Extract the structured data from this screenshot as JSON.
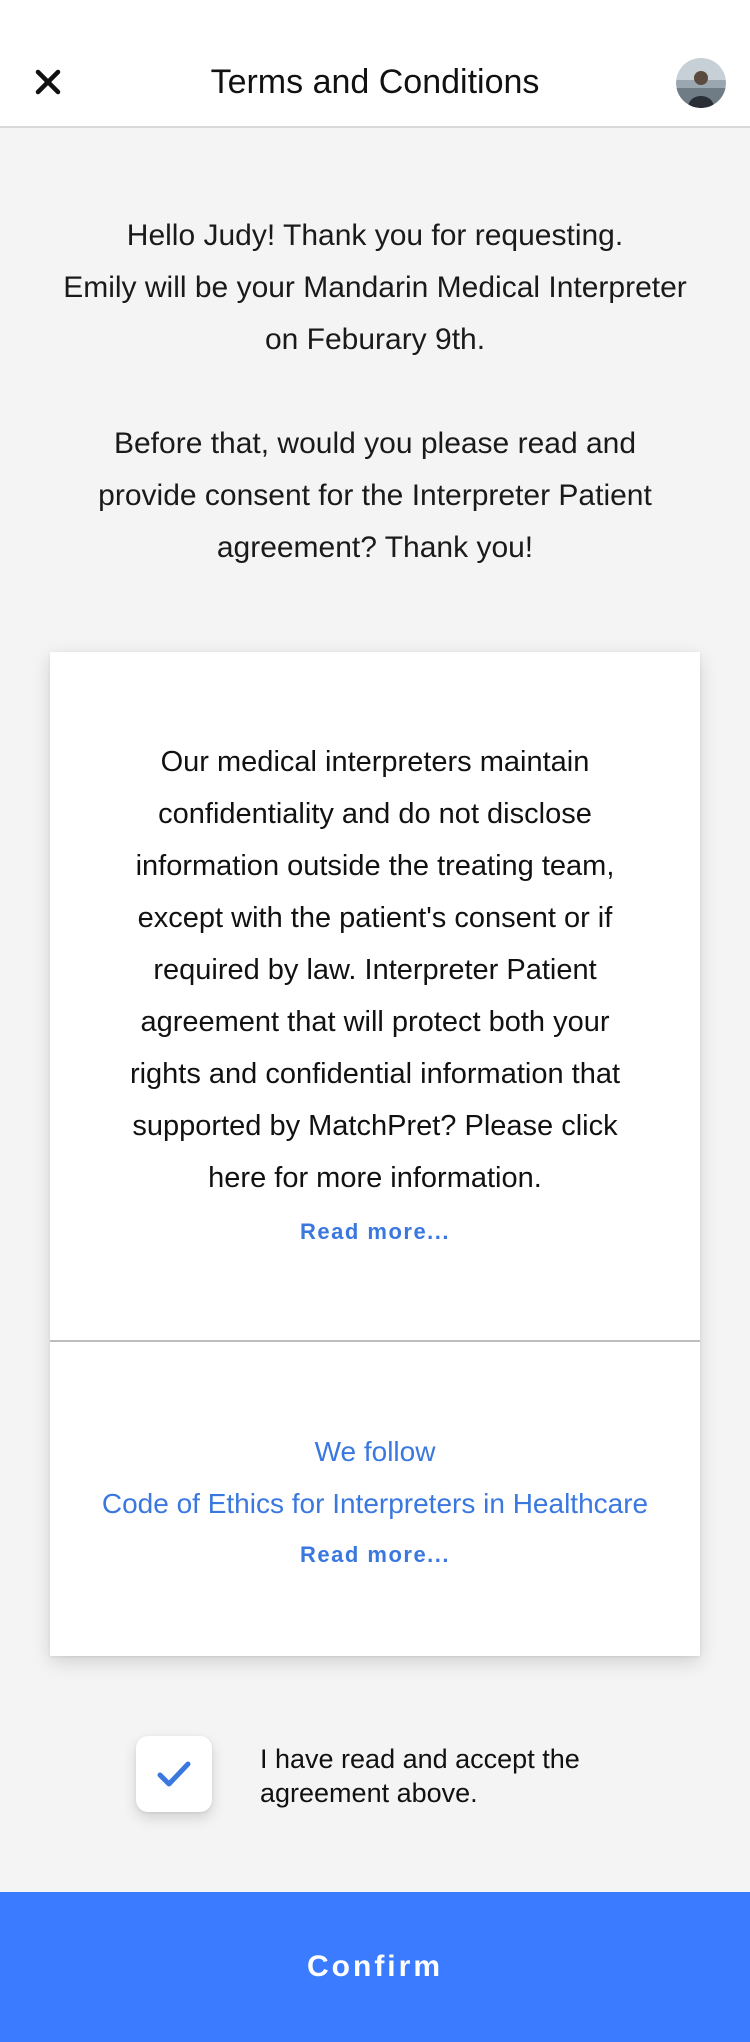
{
  "header": {
    "title": "Terms and Conditions",
    "close_icon": "close-icon",
    "avatar_icon": "user-avatar"
  },
  "intro": {
    "greeting_lines": [
      "Hello Judy! Thank you for requesting.",
      "Emily will be your Mandarin Medical Interpreter",
      "on Feburary 9th."
    ],
    "request_lines": [
      "Before that, would you please read and",
      "provide consent for the Interpreter Patient",
      "agreement? Thank you!"
    ]
  },
  "agreement": {
    "text": "Our medical interpreters maintain confidentiality and do not disclose information outside the treating team, except with the patient's consent or if required by law. Interpreter Patient agreement that will protect both your rights and confidential information that supported by MatchPret? Please click here for more information.",
    "read_more_label": "Read more...",
    "ethics_intro": "We follow",
    "ethics_link": "Code of Ethics for Interpreters in Healthcare",
    "ethics_read_more_label": "Read more..."
  },
  "consent": {
    "checked": true,
    "check_icon": "checkmark-icon",
    "label": "I have read and accept the agreement above."
  },
  "confirm": {
    "label": "Confirm"
  },
  "colors": {
    "accent": "#3b7bff",
    "link": "#3a78e0",
    "background": "#f4f4f4",
    "card": "#ffffff"
  }
}
